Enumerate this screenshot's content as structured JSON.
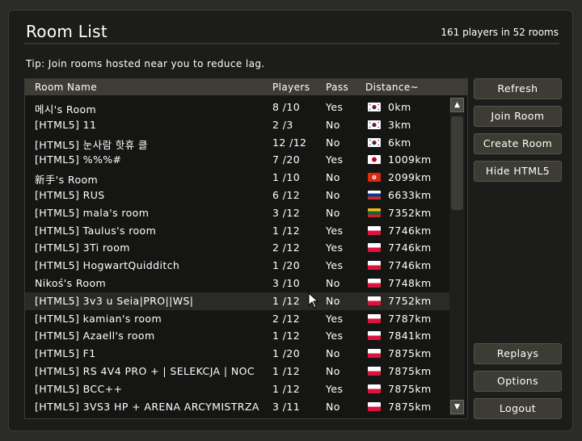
{
  "header": {
    "title": "Room List",
    "player_count": "161 players in 52 rooms"
  },
  "tip": "Tip: Join rooms hosted near you to reduce lag.",
  "columns": {
    "name": "Room Name",
    "players": "Players",
    "pass": "Pass",
    "distance": "Distance~"
  },
  "rooms": [
    {
      "name": "메시's Room",
      "players": "8 /10",
      "pass": "Yes",
      "flag": "kr-flag-icon",
      "distance": "0km"
    },
    {
      "name": "[HTML5] 11",
      "players": "2 /3",
      "pass": "No",
      "flag": "kr-flag-icon",
      "distance": "3km"
    },
    {
      "name": "[HTML5] 눈사람 핫휴 클",
      "players": "12 /12",
      "pass": "No",
      "flag": "kr-flag-icon",
      "distance": "6km"
    },
    {
      "name": "[HTML5] %%%#",
      "players": "7 /20",
      "pass": "Yes",
      "flag": "jp-flag-icon",
      "distance": "1009km"
    },
    {
      "name": "新手's Room",
      "players": "1 /10",
      "pass": "No",
      "flag": "hk-flag-icon",
      "distance": "2099km"
    },
    {
      "name": "[HTML5] RUS",
      "players": "6 /12",
      "pass": "No",
      "flag": "ru-flag-icon",
      "distance": "6633km"
    },
    {
      "name": "[HTML5] mala's room",
      "players": "3 /12",
      "pass": "No",
      "flag": "lt-flag-icon",
      "distance": "7352km"
    },
    {
      "name": "[HTML5] Taulus's room",
      "players": "1 /12",
      "pass": "Yes",
      "flag": "pl-flag-icon",
      "distance": "7746km"
    },
    {
      "name": "[HTML5] 3Ti room",
      "players": "2 /12",
      "pass": "Yes",
      "flag": "pl-flag-icon",
      "distance": "7746km"
    },
    {
      "name": "[HTML5] HogwartQuidditch",
      "players": "1 /20",
      "pass": "Yes",
      "flag": "pl-flag-icon",
      "distance": "7746km"
    },
    {
      "name": "Nikoś's Room",
      "players": "3 /10",
      "pass": "No",
      "flag": "pl-flag-icon",
      "distance": "7748km"
    },
    {
      "name": "[HTML5] 3v3 u Seia|PRO||WS|",
      "players": "1 /12",
      "pass": "No",
      "flag": "pl-flag-icon",
      "distance": "7752km",
      "hover": true
    },
    {
      "name": "[HTML5] kamian's room",
      "players": "2 /12",
      "pass": "Yes",
      "flag": "pl-flag-icon",
      "distance": "7787km"
    },
    {
      "name": "[HTML5] Azaell's room",
      "players": "1 /12",
      "pass": "Yes",
      "flag": "pl-flag-icon",
      "distance": "7841km"
    },
    {
      "name": "[HTML5] F1",
      "players": "1 /20",
      "pass": "No",
      "flag": "pl-flag-icon",
      "distance": "7875km"
    },
    {
      "name": "[HTML5] RS 4V4 PRO + | SELEKCJA | NOC",
      "players": "1 /12",
      "pass": "No",
      "flag": "pl-flag-icon",
      "distance": "7875km"
    },
    {
      "name": "[HTML5] BCC++",
      "players": "1 /12",
      "pass": "Yes",
      "flag": "pl-flag-icon",
      "distance": "7875km"
    },
    {
      "name": "[HTML5] 3VS3 HP + ARENA ARCYMISTRZA",
      "players": "3 /11",
      "pass": "No",
      "flag": "pl-flag-icon",
      "distance": "7875km"
    }
  ],
  "buttons": {
    "refresh": "Refresh",
    "join": "Join Room",
    "create": "Create Room",
    "hide_html5": "Hide HTML5",
    "replays": "Replays",
    "options": "Options",
    "logout": "Logout"
  },
  "scroll": {
    "up_glyph": "▲",
    "down_glyph": "▼"
  },
  "colors": {
    "background": "#1c1c1a",
    "header_bar": "#3e3d35",
    "button": "#3c3b34",
    "hover_row": "#2a2a26"
  }
}
